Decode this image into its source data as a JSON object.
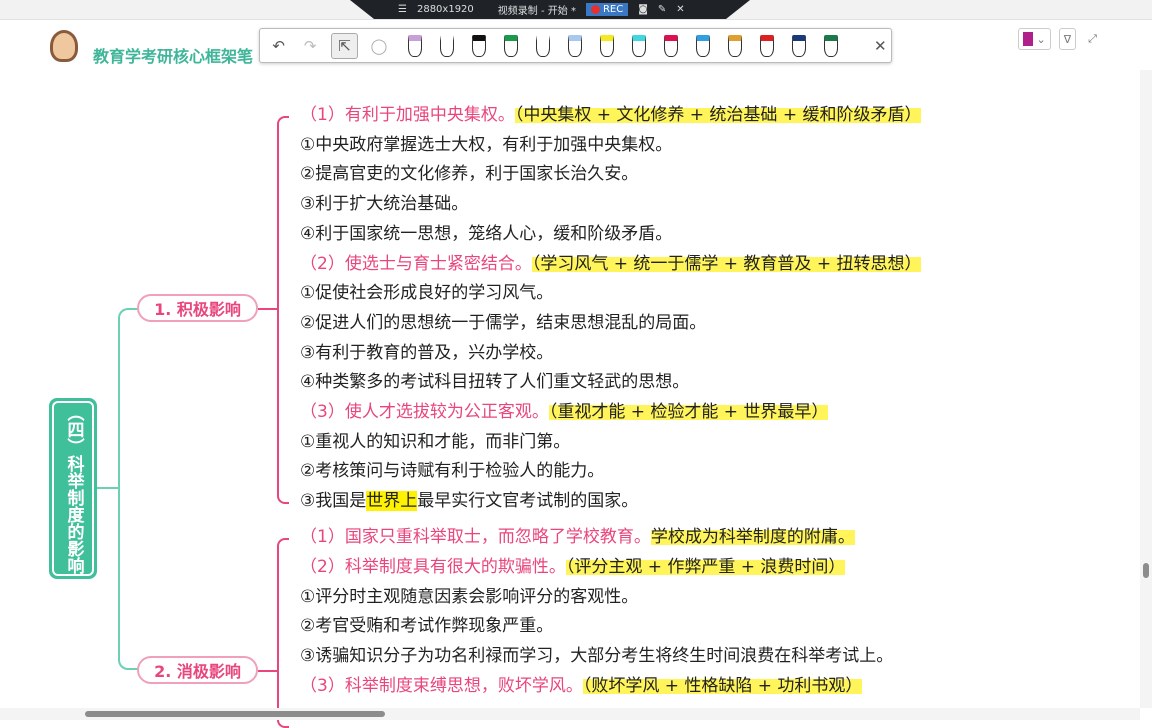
{
  "recorder": {
    "menu_icon": "hamburger-icon",
    "resolution": "2880x1920",
    "title": "视频录制 - 开始 *",
    "rec_label": "REC"
  },
  "header": {
    "title": "教育学考研核心框架笔"
  },
  "toolbar": {
    "undo": "↶",
    "redo": "↷",
    "select": "⇱",
    "lasso": "◯",
    "close": "✕"
  },
  "pens": [
    "#c8a0d8",
    "#ffffff",
    "#111111",
    "#1a9a4a",
    "#ffffff",
    "#a8c8f0",
    "#f5ea20",
    "#40d8e0",
    "#e01050",
    "#30a0e0",
    "#e0a030",
    "#e02020",
    "#1a3a7a",
    "#1a7a4a"
  ],
  "root": {
    "label": "（四）科举制度的影响"
  },
  "branches": [
    {
      "label": "1. 积极影响"
    },
    {
      "label": "2. 消极影响"
    }
  ],
  "lines": [
    [
      {
        "t": "（1）有利于加强中央集权。",
        "s": "pink"
      },
      {
        "t": "（中央集权 + 文化修养 + 统治基础 + 缓和阶级矛盾）",
        "s": "hl"
      }
    ],
    [
      {
        "t": "①中央政府掌握选士大权，有利于加强中央集权。",
        "s": ""
      }
    ],
    [
      {
        "t": "②提高官吏的文化修养，利于国家长治久安。",
        "s": ""
      }
    ],
    [
      {
        "t": "③利于扩大统治基础。",
        "s": ""
      }
    ],
    [
      {
        "t": "④利于国家统一思想，笼络人心，缓和阶级矛盾。",
        "s": ""
      }
    ],
    [
      {
        "t": "（2）使选士与育士紧密结合。",
        "s": "pink"
      },
      {
        "t": "（学习风气 + 统一于儒学 + 教育普及 + 扭转思想）",
        "s": "hl"
      }
    ],
    [
      {
        "t": "①促使社会形成良好的学习风气。",
        "s": ""
      }
    ],
    [
      {
        "t": "②促进人们的思想统一于儒学，结束思想混乱的局面。",
        "s": ""
      }
    ],
    [
      {
        "t": "③有利于教育的普及，兴办学校。",
        "s": ""
      }
    ],
    [
      {
        "t": "④种类繁多的考试科目扭转了人们重文轻武的思想。",
        "s": ""
      }
    ],
    [
      {
        "t": "（3）使人才选拔较为公正客观。",
        "s": "pink"
      },
      {
        "t": "（重视才能 + 检验才能 + 世界最早）",
        "s": "hl"
      }
    ],
    [
      {
        "t": "①重视人的知识和才能，而非门第。",
        "s": ""
      }
    ],
    [
      {
        "t": "②考核策问与诗赋有利于检验人的能力。",
        "s": ""
      }
    ],
    [
      {
        "t": "③我国是",
        "s": ""
      },
      {
        "t": "世界上",
        "s": "hlb"
      },
      {
        "t": "最早实行文官考试制的国家。",
        "s": ""
      }
    ],
    [
      {
        "t": "（1）国家只重科举取士，而忽略了学校教育。",
        "s": "pink"
      },
      {
        "t": "学校成为科举制度的附庸。",
        "s": "hl"
      }
    ],
    [
      {
        "t": "（2）科举制度具有很大的欺骗性。",
        "s": "pink"
      },
      {
        "t": "（评分主观 + 作弊严重 + 浪费时间）",
        "s": "hl"
      }
    ],
    [
      {
        "t": "①评分时主观随意因素会影响评分的客观性。",
        "s": ""
      }
    ],
    [
      {
        "t": "②考官受贿和考试作弊现象严重。",
        "s": ""
      }
    ],
    [
      {
        "t": "③诱骗知识分子为功名利禄而学习，大部分考生将终生时间浪费在科举考试上。",
        "s": ""
      }
    ],
    [
      {
        "t": "（3）科举制度束缚思想，败坏学风。",
        "s": "pink"
      },
      {
        "t": "（败坏学风 + 性格缺陷 + 功利书观）",
        "s": "hl"
      }
    ]
  ]
}
